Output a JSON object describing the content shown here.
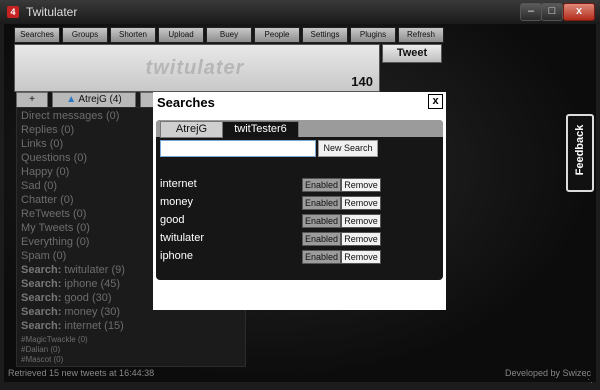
{
  "window": {
    "title": "Twitulater",
    "icon_label": "4",
    "minimize": "–",
    "maximize": "□",
    "close": "x"
  },
  "menu": [
    "Searches",
    "Groups",
    "Shorten URL",
    "Upload",
    "Buey",
    "People",
    "Settings",
    "Plugins",
    "Refresh"
  ],
  "compose": {
    "logo": "twitulater",
    "char_count": "140",
    "tweet_label": "Tweet"
  },
  "tabs": {
    "add": "+",
    "account1": "AtrejG (4)"
  },
  "categories": [
    {
      "label": "Direct messages (0)"
    },
    {
      "label": "Replies (0)"
    },
    {
      "label": "Links (0)"
    },
    {
      "label": "Questions (0)"
    },
    {
      "label": "Happy (0)"
    },
    {
      "label": "Sad (0)"
    },
    {
      "label": "Chatter (0)"
    },
    {
      "label": "ReTweets (0)"
    },
    {
      "label": "My Tweets (0)"
    },
    {
      "label": "Everything (0)"
    },
    {
      "label": "Spam (0)"
    }
  ],
  "search_categories": [
    {
      "prefix": "Search:",
      "label": "twitulater (9)"
    },
    {
      "prefix": "Search:",
      "label": "iphone (45)"
    },
    {
      "prefix": "Search:",
      "label": "good (30)"
    },
    {
      "prefix": "Search:",
      "label": "money (30)"
    },
    {
      "prefix": "Search:",
      "label": "internet (15)"
    }
  ],
  "hashtags": [
    "#MagicTwackle (0)",
    "#Dalian (0)",
    "#Mascot (0)"
  ],
  "status": {
    "left": "Retrieved 15 new tweets at 16:44:38",
    "right": "Developed by Swizec"
  },
  "feedback_label": "Feedback",
  "dialog": {
    "title": "Searches",
    "close": "x",
    "tabs": [
      "AtrejG",
      "twitTester6"
    ],
    "search_value": "",
    "new_search_label": "New Search",
    "enabled_label": "Enabled",
    "remove_label": "Remove",
    "searches": [
      "internet",
      "money",
      "good",
      "twitulater",
      "iphone"
    ]
  },
  "colors": {
    "accent_close": "#b22b1b",
    "dialog_bg": "#ffffff",
    "panel_bg": "#1b1b1b"
  }
}
